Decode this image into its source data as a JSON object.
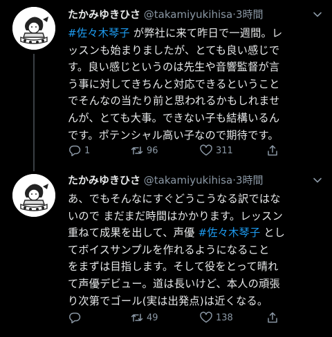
{
  "tweets": [
    {
      "display_name": "たかみゆきひさ",
      "handle": "@takamiyukihisa",
      "separator": "·",
      "time": "3時間",
      "lines": [
        {
          "hashtag": "#佐々木琴子",
          "text": " が弊社に来て昨日で一週間。レ"
        },
        {
          "hashtag": "",
          "text": "ッスンも始まりましたが、とても良い感じで"
        },
        {
          "hashtag": "",
          "text": "す。良い感じというのは先生や音響監督が言"
        },
        {
          "hashtag": "",
          "text": "う事に対してきちんと対応できるということ"
        },
        {
          "hashtag": "",
          "text": "でそんなの当たり前と思われるかもしれませ"
        },
        {
          "hashtag": "",
          "text": "んが、とても大事。できない子も結構いるん"
        },
        {
          "hashtag": "",
          "text": "です。ポテンシャル高い子なので期待です。"
        }
      ],
      "reply_count": "1",
      "retweet_count": "96",
      "like_count": "311",
      "share_count": ""
    },
    {
      "display_name": "たかみゆきひさ",
      "handle": "@takamiyukihisa",
      "separator": "·",
      "time": "3時間",
      "lines": [
        {
          "text_before": "あ、でもそんなにすぐどうこうなる訳ではな",
          "hashtag": "",
          "text": ""
        },
        {
          "text_before": "いので まだまだ時間はかかります。レッスン",
          "hashtag": "",
          "text": ""
        },
        {
          "text_before": "重ねて成果を出して、声優 ",
          "hashtag": "#佐々木琴子",
          "text": " とし"
        },
        {
          "text_before": "てボイスサンプルを作れるようになること",
          "hashtag": "",
          "text": ""
        },
        {
          "text_before": "をまずは目指します。そして役をとって晴れ",
          "hashtag": "",
          "text": ""
        },
        {
          "text_before": "て声優デビュー。道は長いけど、本人の頑張",
          "hashtag": "",
          "text": ""
        },
        {
          "text_before": "り次第でゴール(実は出発点)は近くなる。",
          "hashtag": "",
          "text": ""
        }
      ],
      "reply_count": "",
      "retweet_count": "49",
      "like_count": "138",
      "share_count": ""
    }
  ],
  "icons": {
    "avatar": "avatar-illustration",
    "caret": "chevron-down-icon",
    "reply": "reply-icon",
    "retweet": "retweet-icon",
    "like": "heart-icon",
    "share": "share-icon"
  },
  "colors": {
    "background": "#000000",
    "text": "#e7e9ea",
    "secondary": "#8b98a5",
    "hashtag": "#1d9bf0",
    "thread_line": "#3a3f44"
  }
}
